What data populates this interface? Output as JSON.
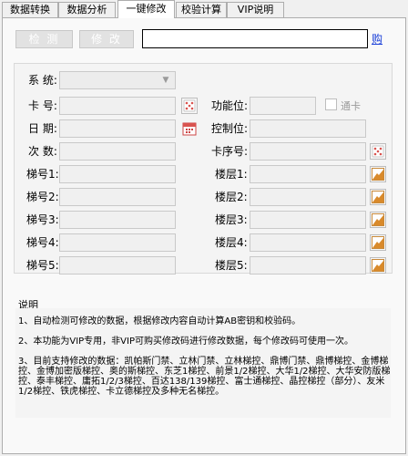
{
  "tabs": [
    {
      "label": "数据转换"
    },
    {
      "label": "数据分析"
    },
    {
      "label": "一键修改"
    },
    {
      "label": "校验计算"
    },
    {
      "label": "VIP说明"
    }
  ],
  "toolbar": {
    "detect_label": "检 测",
    "modify_label": "修 改",
    "input_value": "",
    "buy_label": "购"
  },
  "form": {
    "system_label": "系  统:",
    "system_value": "",
    "card_label": "卡  号:",
    "function_label": "功能位:",
    "checkbox_label": "通卡",
    "date_label": "日  期:",
    "control_label": "控制位:",
    "count_label": "次  数:",
    "card_seq_label": "卡序号:",
    "ladder_labels": [
      "梯号1:",
      "梯号2:",
      "梯号3:",
      "梯号4:",
      "梯号5:"
    ],
    "floor_labels": [
      "楼层1:",
      "楼层2:",
      "楼层3:",
      "楼层4:",
      "楼层5:"
    ]
  },
  "description": {
    "title": "说明",
    "line1": "1、自动检测可修改的数据，根据修改内容自动计算AB密钥和校验码。",
    "line2": "2、本功能为VIP专用，非VIP可购买修改码进行修改数据，每个修改码可使用一次。",
    "line3": "3、目前支持修改的数据：凯帕斯门禁、立林门禁、立林梯控、鼎博门禁、鼎博梯控、金博梯控、金博加密版梯控、奥的斯梯控、东芝1梯控、前景1/2梯控、大华1/2梯控、大华安防版梯控、泰丰梯控、庸拓1/2/3梯控、百达138/139梯控、富士通梯控、晶控梯控（部分）、友米1/2梯控、铁虎梯控、卡立德梯控及多种无名梯控。"
  },
  "colors": {
    "link": "#1a3fd8",
    "icon_orange": "#d98a2b",
    "icon_red": "#d9534f"
  }
}
